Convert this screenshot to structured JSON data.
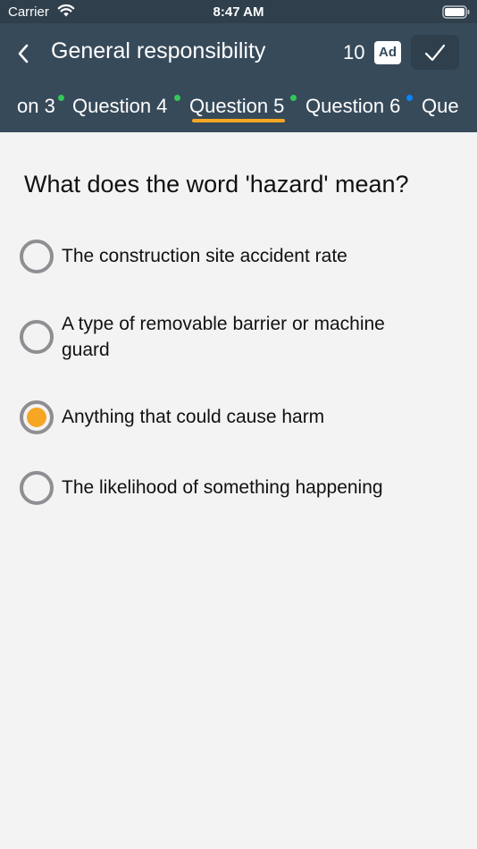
{
  "status_bar": {
    "carrier": "Carrier",
    "time": "8:47 AM"
  },
  "nav": {
    "title": "General responsibility",
    "count": "10",
    "ad_label": "Ad",
    "back_icon": "chevron-left-icon",
    "submit_icon": "checkmark-icon"
  },
  "tabs": [
    {
      "label": "on 3",
      "dot_color": "#34c759"
    },
    {
      "label": "Question 4",
      "dot_color": "#34c759"
    },
    {
      "label": "Question 5",
      "dot_color": "#34c759",
      "active": true
    },
    {
      "label": "Question 6",
      "dot_color": "#0a84ff"
    },
    {
      "label": "Que"
    }
  ],
  "question": {
    "text": "What does the word 'hazard' mean?",
    "options": [
      {
        "text": "The construction site accident rate",
        "selected": false
      },
      {
        "text": "A type of removable barrier or machine guard",
        "selected": false
      },
      {
        "text": "Anything that could cause harm",
        "selected": true
      },
      {
        "text": "The likelihood of something happening",
        "selected": false
      }
    ]
  },
  "colors": {
    "header_bg": "#374a5a",
    "accent": "#f5a623",
    "page_bg": "#f3f3f3"
  }
}
